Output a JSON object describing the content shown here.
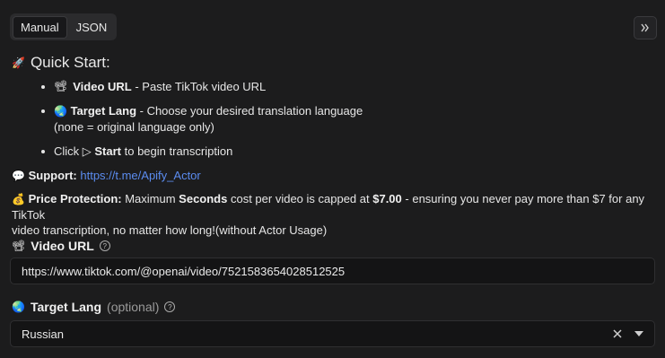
{
  "tabs": [
    {
      "label": "Manual"
    },
    {
      "label": "JSON"
    }
  ],
  "collapse_icon": "double-chevron-right-icon",
  "quick_start": {
    "title": "Quick Start:",
    "icon": "rocket-icon",
    "items": [
      {
        "bold": "Video URL",
        "text": " - Paste TikTok video URL",
        "icon": "film-icon"
      },
      {
        "bold": "Target Lang",
        "text": " - Choose your desired translation language",
        "text2": "(none = original language only)",
        "icon": "globe-icon"
      },
      {
        "prefix": "Click ▷ ",
        "bold": "Start",
        "text": " to begin transcription"
      }
    ]
  },
  "support": {
    "label": "Support:",
    "url": "https://t.me/Apify_Actor",
    "icon": "speech-bubble-icon"
  },
  "price": {
    "label": "Price Protection:",
    "t1": " Maximum ",
    "b1": "Seconds",
    "t2": " cost per video is capped at ",
    "b2": "$7.00",
    "t3": " - ensuring you never pay more than $7 for any TikTok",
    "line2": "video transcription, no matter how long!(without Actor Usage)",
    "icon": "money-bag-icon"
  },
  "video_url": {
    "label": "Video URL",
    "value": "https://www.tiktok.com/@openai/video/7521583654028512525",
    "icon": "film-icon"
  },
  "target_lang": {
    "label": "Target Lang",
    "optional": "(optional)",
    "value": "Russian",
    "icon": "globe-icon"
  }
}
